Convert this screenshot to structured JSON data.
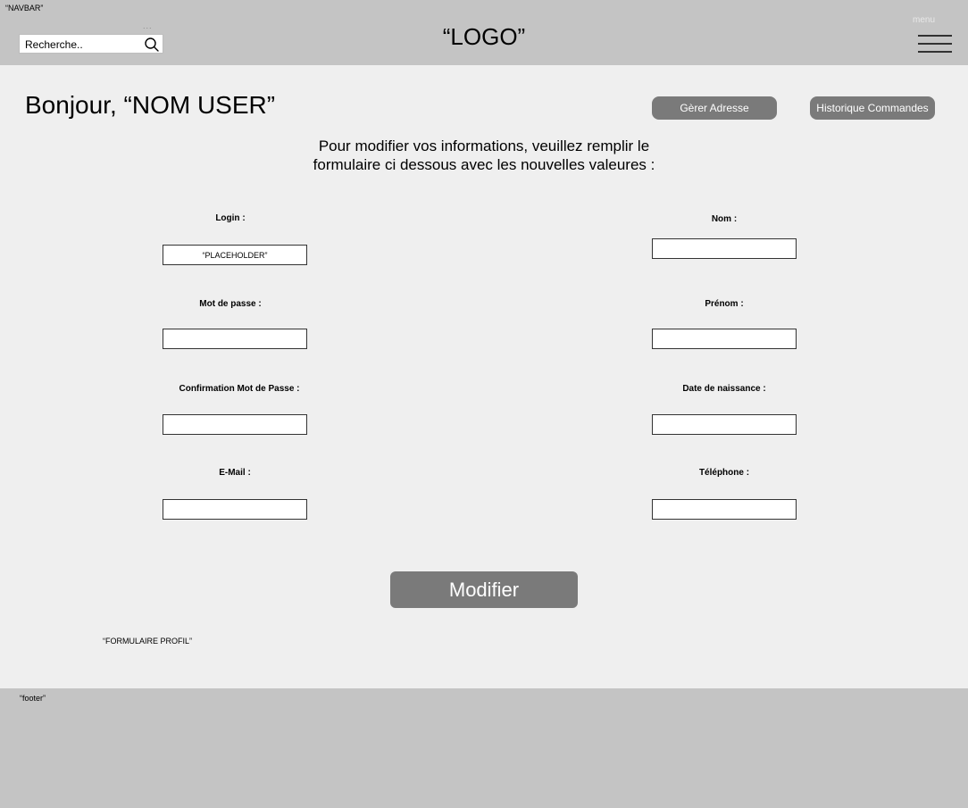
{
  "navbar": {
    "tag": "“NAVBAR”",
    "search_placeholder": "Recherche..",
    "dots": "...",
    "logo": "“LOGO”",
    "menu_label": "menu"
  },
  "header": {
    "greeting": "Bonjour, “NOM USER”",
    "manage_address_label": "Gèrer Adresse",
    "order_history_label": "Historique Commandes"
  },
  "form": {
    "intro": "Pour modifier vos informations, veuillez remplir le formulaire ci dessous avec les nouvelles valeures :",
    "login_label": "Login :",
    "login_placeholder": "“PLACEHOLDER”",
    "password_label": "Mot de passe :",
    "password_confirm_label": "Confirmation Mot de Passe :",
    "email_label": "E-Mail :",
    "nom_label": "Nom :",
    "prenom_label": "Prénom :",
    "birthdate_label": "Date de naissance :",
    "phone_label": "Téléphone :",
    "submit_label": "Modifier",
    "tag": "“FORMULAIRE PROFIL”"
  },
  "footer": {
    "tag": "“footer”"
  }
}
